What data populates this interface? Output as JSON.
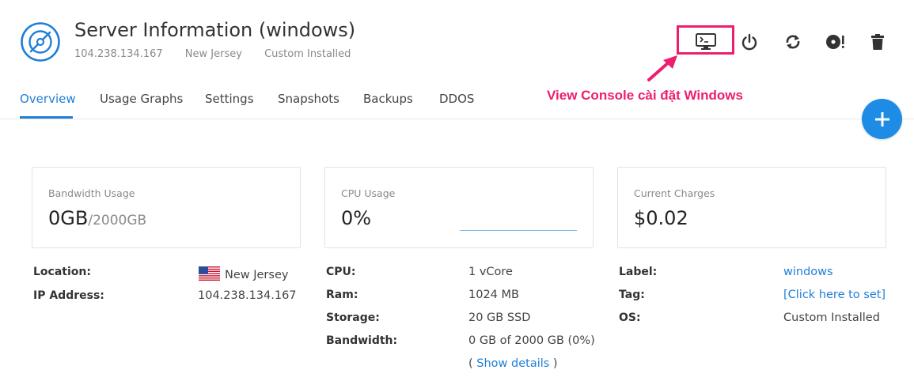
{
  "header": {
    "title": "Server Information (windows)",
    "ip": "104.238.134.167",
    "location": "New Jersey",
    "os": "Custom Installed"
  },
  "actions": {
    "console_icon": "console-monitor-icon",
    "power_icon": "power-icon",
    "restart_icon": "restart-icon",
    "reinstall_icon": "disc-warning-icon",
    "delete_icon": "trash-icon"
  },
  "annotation": {
    "text": "View Console cài đặt Windows",
    "color": "#ee1e6e"
  },
  "tabs": [
    {
      "label": "Overview",
      "active": true
    },
    {
      "label": "Usage Graphs"
    },
    {
      "label": "Settings"
    },
    {
      "label": "Snapshots"
    },
    {
      "label": "Backups"
    },
    {
      "label": "DDOS"
    }
  ],
  "cards": {
    "bandwidth": {
      "label": "Bandwidth Usage",
      "value": "0GB",
      "unit": "/2000GB"
    },
    "cpu": {
      "label": "CPU Usage",
      "value": "0%"
    },
    "charges": {
      "label": "Current Charges",
      "value": "$0.02"
    }
  },
  "details": {
    "location": {
      "label": "Location:",
      "value": "New Jersey"
    },
    "ip": {
      "label": "IP Address:",
      "value": "104.238.134.167"
    },
    "cpu": {
      "label": "CPU:",
      "value": "1 vCore"
    },
    "ram": {
      "label": "Ram:",
      "value": "1024 MB"
    },
    "storage": {
      "label": "Storage:",
      "value": "20 GB SSD"
    },
    "bandwidth": {
      "label": "Bandwidth:",
      "value": "0 GB of 2000 GB (0%)"
    },
    "show_details": {
      "open": "( ",
      "link": "Show details",
      "close": " )"
    },
    "label": {
      "label": "Label:",
      "value": "windows"
    },
    "tag": {
      "label": "Tag:",
      "value": "[Click here to set]"
    },
    "os": {
      "label": "OS:",
      "value": "Custom Installed"
    }
  },
  "colors": {
    "accent": "#1f7ed8",
    "fab": "#1e8ce5",
    "highlight": "#ee1e6e"
  }
}
